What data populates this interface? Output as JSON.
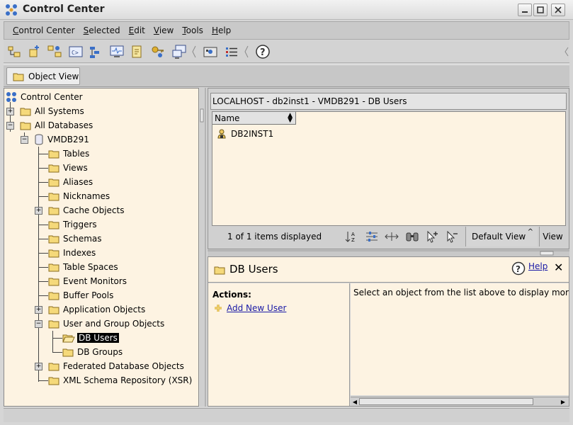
{
  "window": {
    "title": "Control Center"
  },
  "menu": [
    {
      "pre": "C",
      "rest": "ontrol Center"
    },
    {
      "pre": "S",
      "rest": "elected"
    },
    {
      "pre": "E",
      "rest": "dit"
    },
    {
      "pre": "V",
      "rest": "iew"
    },
    {
      "pre": "T",
      "rest": "ools"
    },
    {
      "pre": "H",
      "rest": "elp"
    }
  ],
  "toolbar": {
    "icons": [
      "object-view-icon",
      "commands-icon",
      "replication-icon",
      "command-editor-icon",
      "task-center-icon",
      "health-center-icon",
      "journal-icon",
      "license-icon",
      "configuration-assistant-icon",
      "monitor-icon",
      "show-list-icon",
      "help-icon"
    ]
  },
  "viewbar": {
    "object_view_label": "Object View"
  },
  "tree": {
    "root": "Control Center",
    "all_systems": "All Systems",
    "all_databases": "All Databases",
    "database": "VMDB291",
    "items": [
      "Tables",
      "Views",
      "Aliases",
      "Nicknames",
      "Cache Objects",
      "Triggers",
      "Schemas",
      "Indexes",
      "Table Spaces",
      "Event Monitors",
      "Buffer Pools",
      "Application Objects",
      "User and Group Objects"
    ],
    "sub_items": [
      "DB Users",
      "DB Groups"
    ],
    "after_items": [
      "Federated Database Objects",
      "XML Schema Repository (XSR)"
    ]
  },
  "contents": {
    "breadcrumb": "LOCALHOST - db2inst1 - VMDB291 - DB Users",
    "column_name": "Name",
    "rows": [
      "DB2INST1"
    ],
    "count_text": "1 of 1 items displayed",
    "default_view": "Default View",
    "view_button": "View"
  },
  "details": {
    "title": "DB Users",
    "help": "Help",
    "actions_label": "Actions:",
    "add_user": "Add New User",
    "description": "Select an object from the list above to display more"
  },
  "colors": {
    "panel_bg": "#fdf3e2",
    "folder": "#f5d97a",
    "link": "#1a1aa6"
  }
}
